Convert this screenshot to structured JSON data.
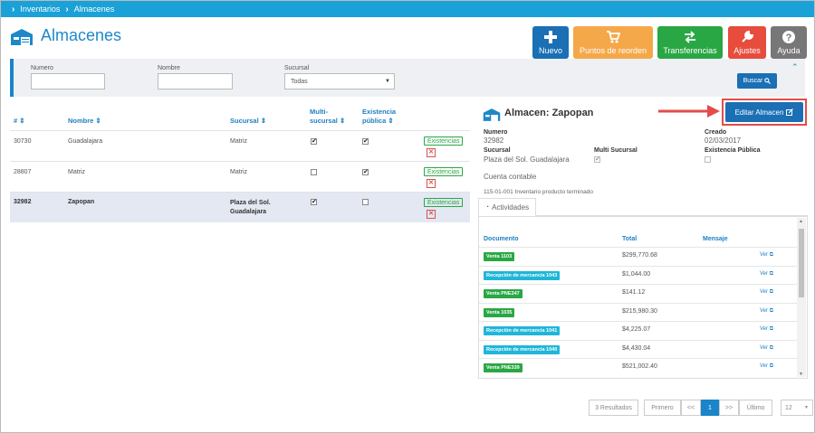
{
  "breadcrumb": {
    "items": [
      "Inventarios",
      "Almacenes"
    ]
  },
  "page": {
    "title": "Almacenes"
  },
  "toolbar": {
    "nuevo": "Nuevo",
    "puntos": "Puntos de reorden",
    "transferencias": "Transferencias",
    "ajustes": "Ajustes",
    "ayuda": "Ayuda",
    "colors": {
      "nuevo": "#1a6fb5",
      "puntos": "#f5a84a",
      "transferencias": "#29a744",
      "ajustes": "#e74c3c",
      "ayuda": "#777777"
    }
  },
  "filters": {
    "numero_label": "Numero",
    "nombre_label": "Nombre",
    "sucursal_label": "Sucursal",
    "sucursal_value": "Todas",
    "buscar": "Buscar"
  },
  "table": {
    "headers": {
      "num": "#",
      "nombre": "Nombre",
      "sucursal": "Sucursal",
      "multi": "Multi-sucursal",
      "existencia": "Existencia pública"
    },
    "multi_line1": "Multi-",
    "multi_line2": "sucursal",
    "exist_line1": "Existencia",
    "exist_line2": "pública",
    "rows": [
      {
        "num": "30730",
        "nombre": "Guadalajara",
        "sucursal": "Matriz",
        "sucursal2": "",
        "multi": true,
        "existencia": true,
        "btn": "Existencias"
      },
      {
        "num": "28807",
        "nombre": "Matriz",
        "sucursal": "Matriz",
        "sucursal2": "",
        "multi": false,
        "existencia": true,
        "btn": "Existencias"
      },
      {
        "num": "32982",
        "nombre": "Zapopan",
        "sucursal": "Plaza del Sol.",
        "sucursal2": "Guadalajara",
        "multi": true,
        "existencia": false,
        "btn": "Existencias"
      }
    ]
  },
  "detail": {
    "title": "Almacen: Zapopan",
    "editar": "Editar Almacen",
    "numero_label": "Numero",
    "numero": "32982",
    "creado_label": "Creado",
    "creado": "02/03/2017",
    "sucursal_label": "Sucursal",
    "sucursal": "Plaza del Sol. Guadalajara",
    "multi_label": "Multi Sucursal",
    "existencia_label": "Existencia Pública",
    "cuenta_label": "Cuenta contable",
    "cuenta": "115-01-001 Inventario producto terminado",
    "tab": "Actividades"
  },
  "activities": {
    "headers": {
      "documento": "Documento",
      "total": "Total",
      "mensaje": "Mensaje"
    },
    "rows": [
      {
        "doc": "Venta 1103",
        "type": "venta",
        "total": "$299,770.68",
        "ver": "Ver"
      },
      {
        "doc": "Recepción de mercancía 1043",
        "type": "recepcion",
        "total": "$1,044.00",
        "ver": "Ver"
      },
      {
        "doc": "Venta PNE347",
        "type": "venta",
        "total": "$141.12",
        "ver": "Ver"
      },
      {
        "doc": "Venta 1035",
        "type": "venta",
        "total": "$215,980.30",
        "ver": "Ver"
      },
      {
        "doc": "Recepción de mercancía 1041",
        "type": "recepcion",
        "total": "$4,225.07",
        "ver": "Ver"
      },
      {
        "doc": "Recepción de mercancía 1040",
        "type": "recepcion",
        "total": "$4,430.04",
        "ver": "Ver"
      },
      {
        "doc": "Venta PNE339",
        "type": "venta",
        "total": "$521,002.40",
        "ver": "Ver"
      }
    ],
    "colors": {
      "venta": "#29a744",
      "recepcion": "#1fb6d9"
    }
  },
  "pagination": {
    "resultados": "3 Resultados",
    "primero": "Primero",
    "prev": "<<",
    "current": "1",
    "next": ">>",
    "ultimo": "Último",
    "page_size": "12"
  }
}
